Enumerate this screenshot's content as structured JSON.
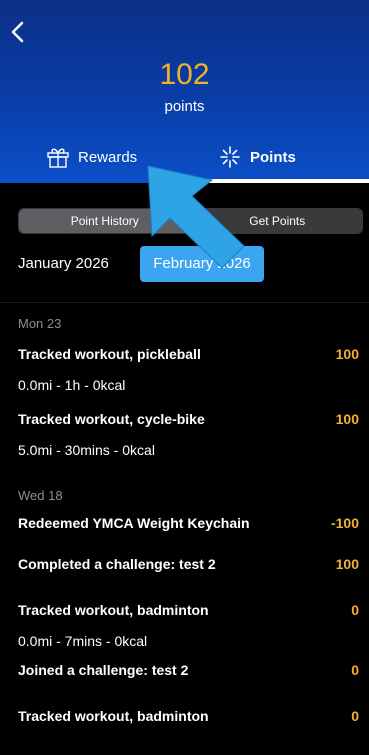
{
  "header": {
    "points_value": "102",
    "points_label": "points",
    "tabs": [
      {
        "label": "Rewards",
        "icon": "gift-icon"
      },
      {
        "label": "Points",
        "icon": "sparkle-icon"
      }
    ],
    "colors": {
      "gradient_top": "#0b2f86",
      "gradient_bottom": "#0b4fc8",
      "points_accent": "#f3b02c"
    }
  },
  "segments": [
    "Point History",
    "Get Points"
  ],
  "months": [
    "January 2026",
    "February 2026"
  ],
  "history": [
    {
      "day": "Mon 23",
      "entries": [
        {
          "title": "Tracked workout, pickleball",
          "points": "100",
          "detail": "0.0mi - 1h - 0kcal"
        },
        {
          "title": "Tracked workout, cycle-bike",
          "points": "100",
          "detail": "5.0mi - 30mins - 0kcal"
        }
      ]
    },
    {
      "day": "Wed 18",
      "entries": [
        {
          "title": "Redeemed YMCA Weight Keychain",
          "points": "-100"
        },
        {
          "title": "Completed a challenge: test 2",
          "points": "100"
        },
        {
          "title": "Tracked workout, badminton",
          "points": "0",
          "detail": "0.0mi - 7mins - 0kcal"
        },
        {
          "title": "Joined a challenge: test 2",
          "points": "0"
        },
        {
          "title": "Tracked workout, badminton",
          "points": "0"
        }
      ]
    }
  ],
  "annotation": {
    "color": "#2ea3e6"
  }
}
